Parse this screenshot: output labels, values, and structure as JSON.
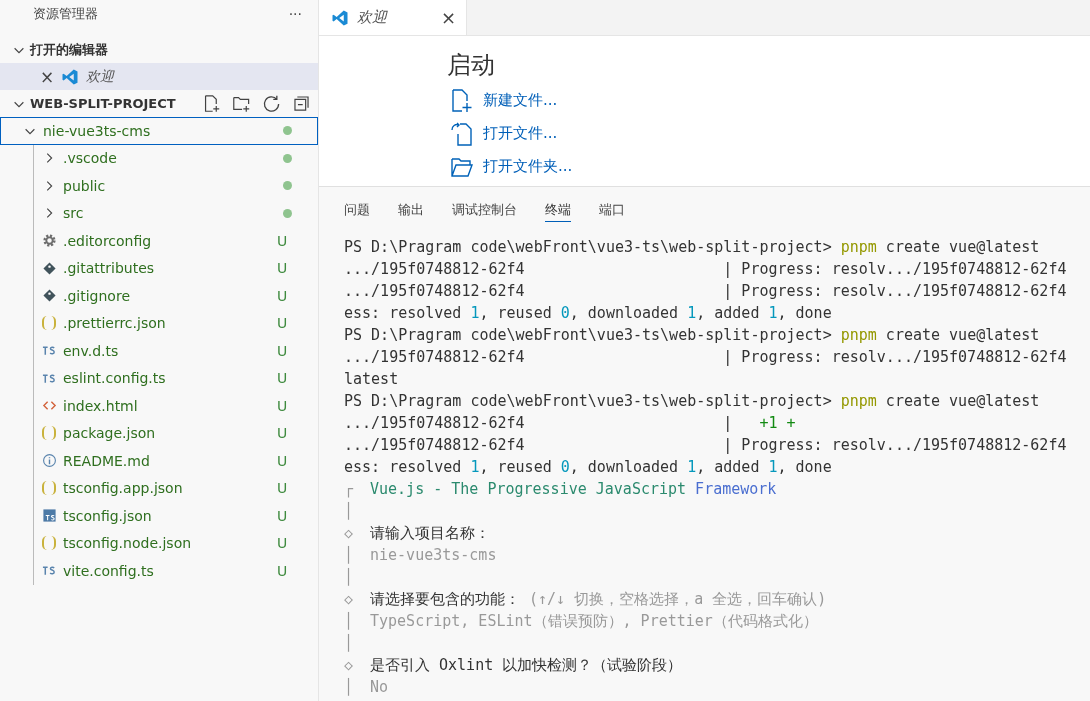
{
  "sidebar": {
    "title": "资源管理器",
    "more": "···",
    "open_editors": {
      "label": "打开的编辑器",
      "expanded": true,
      "items": [
        {
          "close": "×",
          "label": "欢迎",
          "selected": true
        }
      ]
    },
    "project": {
      "label": "WEB-SPLIT-PROJECT",
      "expanded": true,
      "items": [
        {
          "label": "nie-vue3ts-cms",
          "expanded": true,
          "selected": true,
          "dot": true,
          "children": [
            {
              "label": ".vscode",
              "kind": "folder",
              "expanded": false,
              "selected": false,
              "dot": true
            },
            {
              "label": "public",
              "kind": "folder",
              "expanded": false,
              "selected": false,
              "dot": true
            },
            {
              "label": "src",
              "kind": "folder",
              "expanded": false,
              "selected": false,
              "dot": true
            },
            {
              "label": ".editorconfig",
              "kind": "gear",
              "selected": false,
              "badge": "U"
            },
            {
              "label": ".gitattributes",
              "kind": "git",
              "selected": false,
              "badge": "U"
            },
            {
              "label": ".gitignore",
              "kind": "git",
              "selected": false,
              "badge": "U"
            },
            {
              "label": ".prettierrc.json",
              "kind": "braces",
              "selected": false,
              "badge": "U"
            },
            {
              "label": "env.d.ts",
              "kind": "ts",
              "selected": false,
              "badge": "U"
            },
            {
              "label": "eslint.config.ts",
              "kind": "ts",
              "selected": false,
              "badge": "U"
            },
            {
              "label": "index.html",
              "kind": "html",
              "selected": false,
              "badge": "U"
            },
            {
              "label": "package.json",
              "kind": "braces",
              "selected": false,
              "badge": "U"
            },
            {
              "label": "README.md",
              "kind": "info",
              "selected": false,
              "badge": "U"
            },
            {
              "label": "tsconfig.app.json",
              "kind": "braces",
              "selected": false,
              "badge": "U"
            },
            {
              "label": "tsconfig.json",
              "kind": "tsbox",
              "selected": false,
              "badge": "U"
            },
            {
              "label": "tsconfig.node.json",
              "kind": "braces",
              "selected": false,
              "badge": "U"
            },
            {
              "label": "vite.config.ts",
              "kind": "ts",
              "selected": false,
              "badge": "U"
            }
          ]
        }
      ]
    }
  },
  "editor": {
    "tabs": [
      {
        "label": "欢迎",
        "close": "×",
        "selected": true
      }
    ],
    "heading": "启动",
    "links": [
      {
        "kind": "new-file",
        "label": "新建文件..."
      },
      {
        "kind": "open-file",
        "label": "打开文件..."
      },
      {
        "kind": "open-folder",
        "label": "打开文件夹..."
      }
    ]
  },
  "panel": {
    "tabs": [
      {
        "label": "问题",
        "selected": false
      },
      {
        "label": "输出",
        "selected": false
      },
      {
        "label": "调试控制台",
        "selected": false
      },
      {
        "label": "终端",
        "selected": true
      },
      {
        "label": "端口",
        "selected": false
      }
    ],
    "terminal": [
      [
        {
          "t": "PS D:\\Pragram code\\webFront\\vue3-ts\\web-split-project> ",
          "kind": "plain"
        },
        {
          "t": "pnpm",
          "kind": "cmd"
        },
        {
          "t": " create vue@latest",
          "kind": "plain"
        }
      ],
      [
        {
          "t": ".../195f0748812-62f4                      | Progress: resolv.../195f0748812-62f4",
          "kind": "plain"
        }
      ],
      [
        {
          "t": ".../195f0748812-62f4                      | Progress: resolv.../195f0748812-62f4",
          "kind": "plain"
        }
      ],
      [
        {
          "t": "ess: resolved ",
          "kind": "plain"
        },
        {
          "t": "1",
          "kind": "num"
        },
        {
          "t": ", reused ",
          "kind": "plain"
        },
        {
          "t": "0",
          "kind": "num"
        },
        {
          "t": ", downloaded ",
          "kind": "plain"
        },
        {
          "t": "1",
          "kind": "num"
        },
        {
          "t": ", added ",
          "kind": "plain"
        },
        {
          "t": "1",
          "kind": "num"
        },
        {
          "t": ", done",
          "kind": "plain"
        }
      ],
      [
        {
          "t": "PS D:\\Pragram code\\webFront\\vue3-ts\\web-split-project> ",
          "kind": "plain"
        },
        {
          "t": "pnpm",
          "kind": "cmd"
        },
        {
          "t": " create vue@latest",
          "kind": "plain"
        }
      ],
      [
        {
          "t": ".../195f0748812-62f4                      | Progress: resolv.../195f0748812-62f4",
          "kind": "plain"
        }
      ],
      [
        {
          "t": "latest",
          "kind": "plain"
        }
      ],
      [
        {
          "t": "PS D:\\Pragram code\\webFront\\vue3-ts\\web-split-project> ",
          "kind": "plain"
        },
        {
          "t": "pnpm",
          "kind": "cmd"
        },
        {
          "t": " create vue@latest",
          "kind": "plain"
        }
      ],
      [
        {
          "t": ".../195f0748812-62f4                      |   ",
          "kind": "plain"
        },
        {
          "t": "+1 +",
          "kind": "added"
        }
      ],
      [
        {
          "t": ".../195f0748812-62f4                      | Progress: resolv.../195f0748812-62f4",
          "kind": "plain"
        }
      ],
      [
        {
          "t": "ess: resolved ",
          "kind": "plain"
        },
        {
          "t": "1",
          "kind": "num"
        },
        {
          "t": ", reused ",
          "kind": "plain"
        },
        {
          "t": "0",
          "kind": "num"
        },
        {
          "t": ", downloaded ",
          "kind": "plain"
        },
        {
          "t": "1",
          "kind": "num"
        },
        {
          "t": ", added ",
          "kind": "plain"
        },
        {
          "t": "1",
          "kind": "num"
        },
        {
          "t": ", done",
          "kind": "plain"
        }
      ],
      [
        {
          "t": "┌",
          "kind": "gutter"
        },
        {
          "t": "Vue.js - The Progressive JavaScript ",
          "kind": "brand"
        },
        {
          "t": "Framework",
          "kind": "brand-end"
        }
      ],
      [
        {
          "t": "│",
          "kind": "gutter"
        }
      ],
      [
        {
          "t": "◇",
          "kind": "gutter"
        },
        {
          "t": "请输入项目名称：",
          "kind": "plain"
        }
      ],
      [
        {
          "t": "│",
          "kind": "gutter"
        },
        {
          "t": "nie-vue3ts-cms",
          "kind": "dim"
        }
      ],
      [
        {
          "t": "│",
          "kind": "gutter"
        }
      ],
      [
        {
          "t": "◇",
          "kind": "gutter"
        },
        {
          "t": "请选择要包含的功能： ",
          "kind": "plain"
        },
        {
          "t": "(↑/↓ 切换，空格选择，a 全选，回车确认)",
          "kind": "dim"
        }
      ],
      [
        {
          "t": "│",
          "kind": "gutter"
        },
        {
          "t": "TypeScript, ESLint（错误预防）, Prettier（代码格式化）",
          "kind": "dim"
        }
      ],
      [
        {
          "t": "│",
          "kind": "gutter"
        }
      ],
      [
        {
          "t": "◇",
          "kind": "gutter"
        },
        {
          "t": "是否引入 Oxlint 以加快检测？（试验阶段）",
          "kind": "plain"
        }
      ],
      [
        {
          "t": "│",
          "kind": "gutter"
        },
        {
          "t": "No",
          "kind": "dim"
        }
      ]
    ]
  }
}
